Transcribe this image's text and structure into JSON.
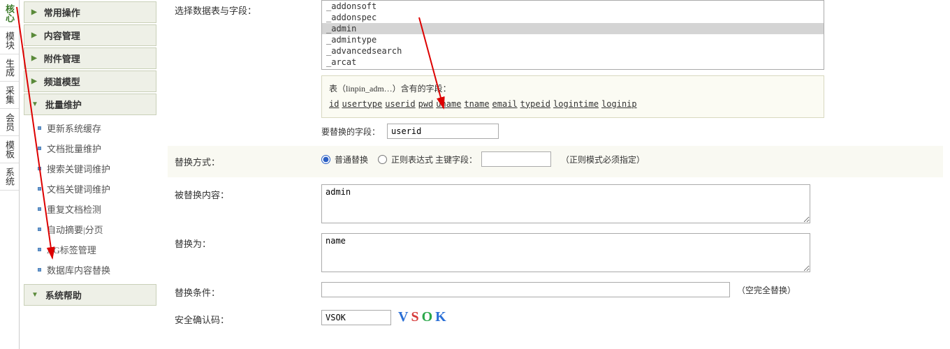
{
  "vtabs": [
    "核心",
    "模块",
    "生成",
    "采集",
    "会员",
    "模板",
    "系统"
  ],
  "sidebar": {
    "sections": [
      {
        "label": "常用操作",
        "expanded": false
      },
      {
        "label": "内容管理",
        "expanded": false
      },
      {
        "label": "附件管理",
        "expanded": false
      },
      {
        "label": "频道模型",
        "expanded": false
      },
      {
        "label": "批量维护",
        "expanded": true,
        "items": [
          "更新系统缓存",
          "文档批量维护",
          "搜索关键词维护",
          "文档关键词维护",
          "重复文档检测",
          "自动摘要|分页",
          "AG标签管理",
          "数据库内容替换"
        ]
      },
      {
        "label": "系统帮助",
        "expanded": false
      }
    ]
  },
  "form": {
    "select_label": "选择数据表与字段：",
    "tables": [
      "_addonsoft",
      "_addonspec",
      "_admin",
      "_admintype",
      "_advancedsearch",
      "_arcat"
    ],
    "table_selected_idx": 2,
    "fields_header": "表（linpin_adm…）含有的字段：",
    "fields": [
      "id",
      "usertype",
      "userid",
      "pwd",
      "uname",
      "tname",
      "email",
      "typeid",
      "logintime",
      "loginip"
    ],
    "replace_field_label": "要替换的字段：",
    "replace_field_value": "userid",
    "method_label": "替换方式：",
    "method_normal": "普通替换",
    "method_regex": "正则表达式 主键字段：",
    "method_hint": "（正则模式必须指定）",
    "replaced_label": "被替换内容：",
    "replaced_value": "admin",
    "replace_to_label": "替换为：",
    "replace_to_value": "name",
    "condition_label": "替换条件：",
    "condition_hint": "（空完全替换）",
    "captcha_label": "安全确认码：",
    "captcha_value": "VSOK",
    "captcha_image": "VSOK"
  }
}
